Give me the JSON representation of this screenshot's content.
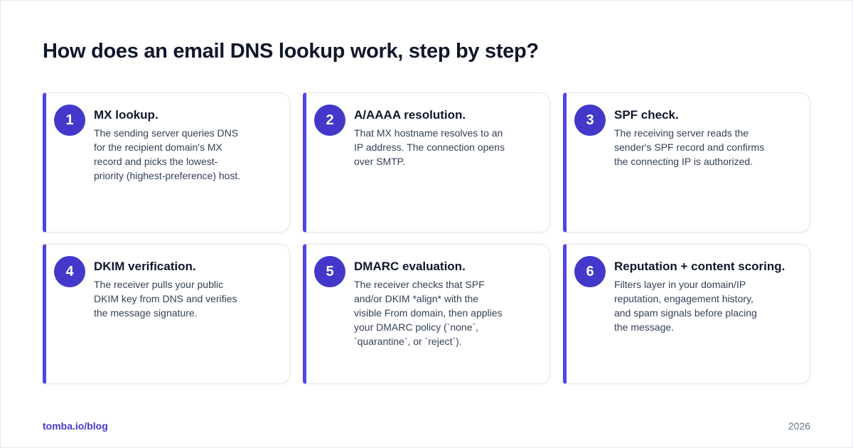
{
  "title": "How does an email DNS lookup work, step by step?",
  "accent_color": "#4338ca",
  "steps": [
    {
      "number": "1",
      "title": "MX lookup.",
      "description": "The sending server queries DNS for the recipient domain's MX record and picks the lowest-priority (highest-preference) host."
    },
    {
      "number": "2",
      "title": "A/AAAA resolution.",
      "description": "That MX hostname resolves to an IP address. The connection opens over SMTP."
    },
    {
      "number": "3",
      "title": "SPF check.",
      "description": "The receiving server reads the sender's SPF record and confirms the connecting IP is authorized."
    },
    {
      "number": "4",
      "title": "DKIM verification.",
      "description": "The receiver pulls your public DKIM key from DNS and verifies the message signature."
    },
    {
      "number": "5",
      "title": "DMARC evaluation.",
      "description": "The receiver checks that SPF and/or DKIM *align* with the visible From domain, then applies your DMARC policy (`none`, `quarantine`, or `reject`)."
    },
    {
      "number": "6",
      "title": "Reputation + content scoring.",
      "description": "Filters layer in your domain/IP reputation, engagement history, and spam signals before placing the message."
    }
  ],
  "footer": {
    "brand": "tomba.io/blog",
    "year": "2026"
  }
}
